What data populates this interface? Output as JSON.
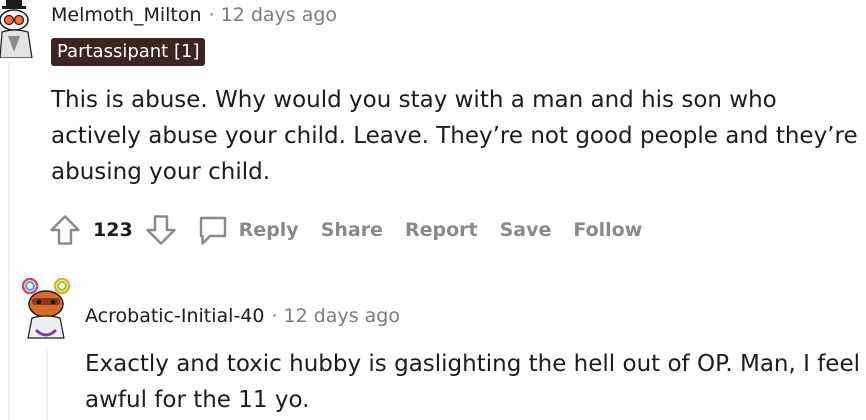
{
  "comments": [
    {
      "username": "Melmoth_Milton",
      "separator": "·",
      "time": "12 days ago",
      "flair": "Partassipant [1]",
      "body": "This is abuse. Why would you stay with a man and his son who actively abuse your child. Leave. They’re not good people and they’re abusing your child.",
      "actions": {
        "upvote_icon": "arrow-up-outline",
        "vote_count": "123",
        "downvote_icon": "arrow-down-outline",
        "reply_icon": "speech-bubble-outline",
        "reply": "Reply",
        "share": "Share",
        "report": "Report",
        "save": "Save",
        "follow": "Follow"
      }
    },
    {
      "username": "Acrobatic-Initial-40",
      "separator": "·",
      "time": "12 days ago",
      "body": "Exactly and toxic hubby is gaslighting the hell out of OP. Man, I feel awful for the 11 yo."
    }
  ],
  "colors": {
    "text": "#1c1c1c",
    "meta": "#7c7c7c",
    "action": "#878a8c",
    "flair_bg": "#3d2420",
    "flair_text": "#ffffff",
    "thread_line": "#edeff1"
  }
}
